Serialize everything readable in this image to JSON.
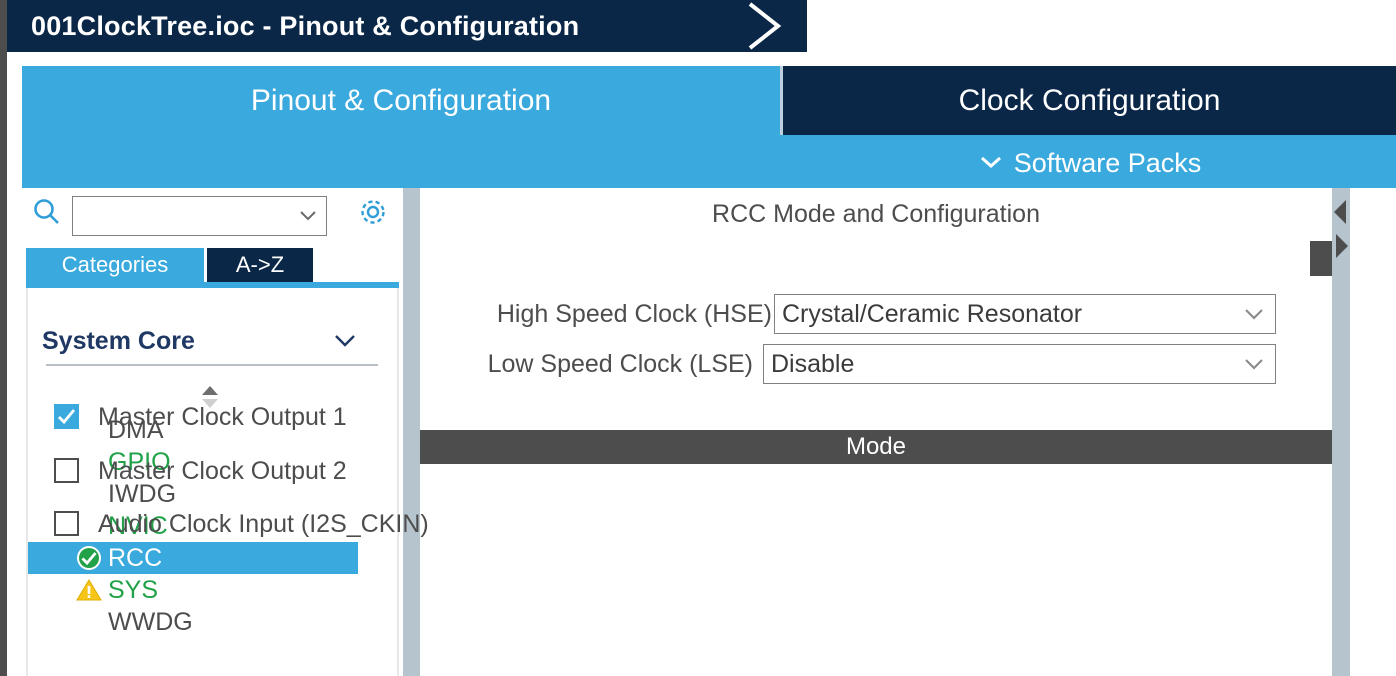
{
  "titlebar": {
    "text": "001ClockTree.ioc - Pinout & Configuration",
    "chevron_icon": "chevron-right-outline-icon",
    "bg": "#0b2748"
  },
  "tabs": {
    "pinout_label": "Pinout & Configuration",
    "clock_label": "Clock Configuration",
    "software_packs_label": "Software Packs",
    "software_packs_icon": "chevron-down-icon",
    "active": "Clock Configuration",
    "active_bg": "#0b2748",
    "inactive_bg": "#3aa9dd"
  },
  "sidebar": {
    "search": {
      "icon": "search-icon",
      "value": "",
      "placeholder": "",
      "caret_icon": "chevron-down-icon"
    },
    "settings_icon": "gear-icon",
    "view_tabs": [
      {
        "label": "Categories",
        "active": true
      },
      {
        "label": "A->Z",
        "active": false
      }
    ],
    "group": {
      "title": "System Core",
      "collapse_icon": "chevron-down-icon",
      "scroll_icon": "up-down-spinner-icon"
    },
    "items": [
      {
        "label": "DMA",
        "state": "plain",
        "color": "#4d4d4d",
        "icon": "none",
        "selected": false
      },
      {
        "label": "GPIO",
        "state": "ok",
        "color": "#21a148",
        "icon": "none",
        "selected": false
      },
      {
        "label": "IWDG",
        "state": "plain",
        "color": "#4d4d4d",
        "icon": "none",
        "selected": false
      },
      {
        "label": "NVIC",
        "state": "ok",
        "color": "#21a148",
        "icon": "none",
        "selected": false
      },
      {
        "label": "RCC",
        "state": "ok",
        "color": "#ffffff",
        "icon": "check-circle-icon",
        "selected": true
      },
      {
        "label": "SYS",
        "state": "warning",
        "color": "#21a148",
        "icon": "warning-triangle-icon",
        "selected": false
      },
      {
        "label": "WWDG",
        "state": "plain",
        "color": "#4d4d4d",
        "icon": "none",
        "selected": false
      }
    ]
  },
  "main": {
    "title": "RCC Mode and Configuration",
    "mode_header": "Mode",
    "selects": [
      {
        "label": "High Speed Clock (HSE)",
        "value": "Crystal/Ceramic Resonator",
        "caret_icon": "chevron-down-icon"
      },
      {
        "label": "Low Speed Clock (LSE)",
        "value": "Disable",
        "caret_icon": "chevron-down-icon"
      }
    ],
    "checkboxes": [
      {
        "label": "Master Clock Output 1",
        "checked": true
      },
      {
        "label": "Master Clock Output 2",
        "checked": false
      },
      {
        "label": "Audio Clock Input (I2S_CKIN)",
        "checked": false
      }
    ]
  },
  "edge": {
    "collapse_left_icon": "triangle-left-icon",
    "expand_right_icon": "triangle-right-icon"
  },
  "colors": {
    "accent_blue": "#3aa9dd",
    "navy": "#0b2748",
    "mode_gray": "#4d4d4d",
    "green": "#21a148",
    "warning_yellow": "#f5c518",
    "strip_gray": "#b6c4ce"
  }
}
